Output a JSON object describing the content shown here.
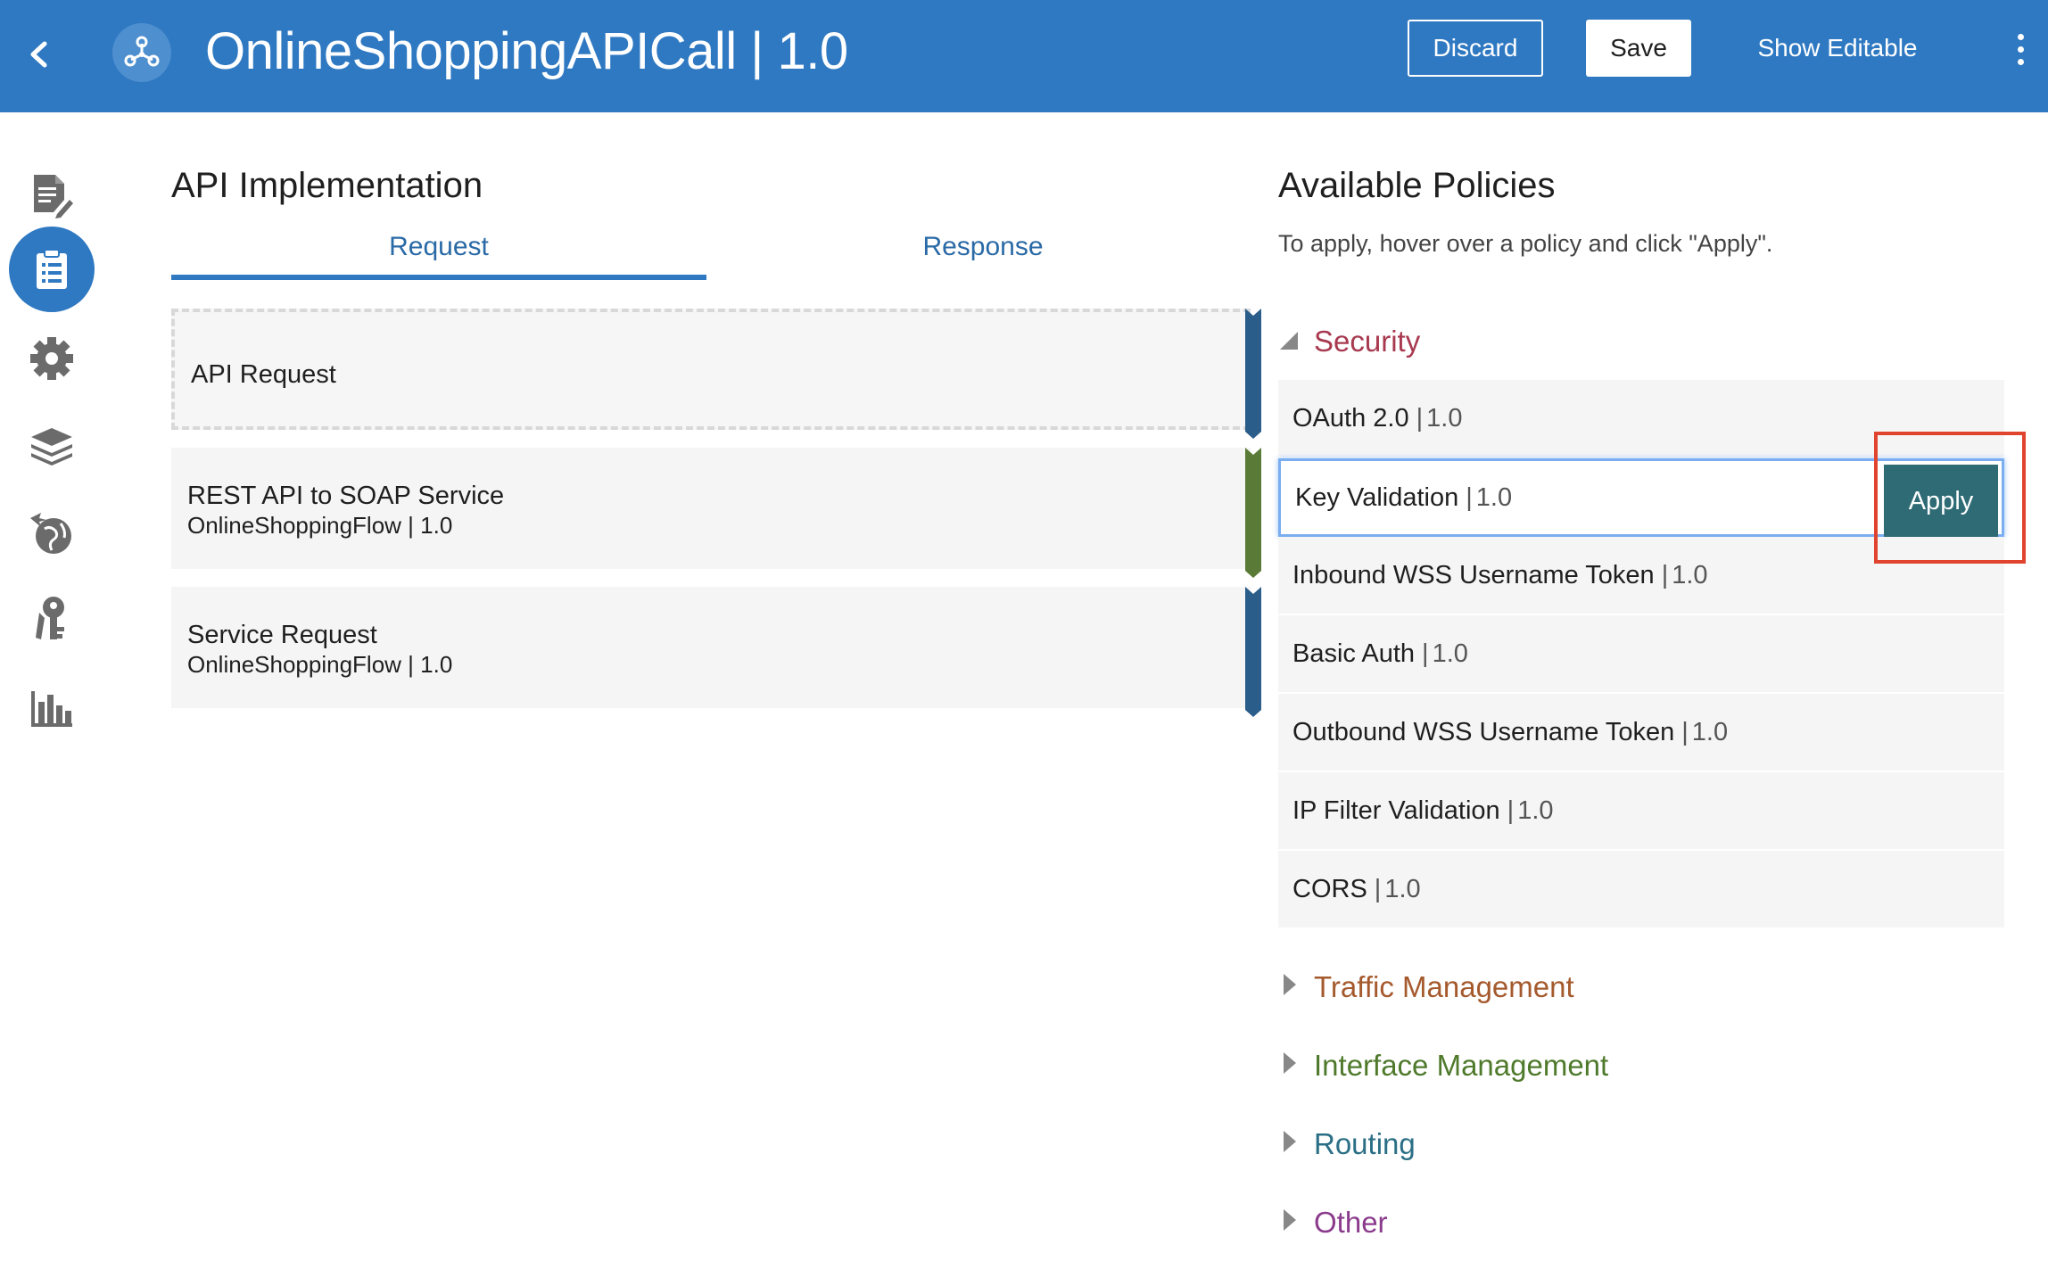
{
  "header": {
    "title": "OnlineShoppingAPICall | 1.0",
    "discard_label": "Discard",
    "save_label": "Save",
    "show_editable_label": "Show Editable"
  },
  "sidenav": {
    "items": [
      {
        "icon": "document-edit-icon"
      },
      {
        "icon": "clipboard-list-icon",
        "active": true
      },
      {
        "icon": "gear-icon"
      },
      {
        "icon": "layers-icon"
      },
      {
        "icon": "globe-deploy-icon"
      },
      {
        "icon": "keys-icon"
      },
      {
        "icon": "bar-chart-icon"
      }
    ]
  },
  "implementation": {
    "title": "API Implementation",
    "tabs": [
      {
        "label": "Request",
        "active": true
      },
      {
        "label": "Response",
        "active": false
      }
    ],
    "flow": [
      {
        "title": "API Request",
        "subtitle": ""
      },
      {
        "title": "REST API to SOAP Service",
        "subtitle": "OnlineShoppingFlow | 1.0"
      },
      {
        "title": "Service Request",
        "subtitle": "OnlineShoppingFlow | 1.0"
      }
    ]
  },
  "policies": {
    "title": "Available Policies",
    "hint": "To apply, hover over a policy and click \"Apply\".",
    "apply_label": "Apply",
    "security": {
      "label": "Security",
      "items": [
        {
          "name": "OAuth 2.0",
          "version": "1.0"
        },
        {
          "name": "Key Validation",
          "version": "1.0"
        },
        {
          "name": "Inbound WSS Username Token",
          "version": "1.0"
        },
        {
          "name": "Basic Auth",
          "version": "1.0"
        },
        {
          "name": "Outbound WSS Username Token",
          "version": "1.0"
        },
        {
          "name": "IP Filter Validation",
          "version": "1.0"
        },
        {
          "name": "CORS",
          "version": "1.0"
        }
      ]
    },
    "categories": [
      {
        "label": "Traffic Management"
      },
      {
        "label": "Interface Management"
      },
      {
        "label": "Routing"
      },
      {
        "label": "Other"
      }
    ]
  },
  "colors": {
    "header_bg": "#2f79c2",
    "security": "#a8394f",
    "traffic": "#a55a2e",
    "interface": "#4f7a2c",
    "routing": "#2b6f86",
    "other": "#8a3b8c",
    "apply_bg": "#2f6b75"
  }
}
